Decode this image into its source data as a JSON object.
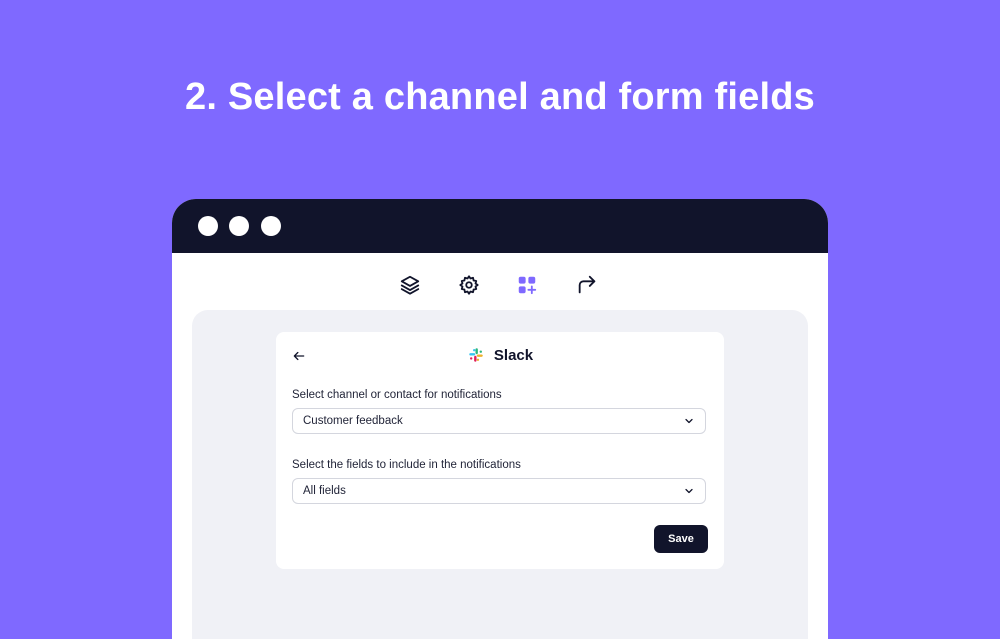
{
  "headline": "2. Select a channel and form fields",
  "toolbar": {
    "items": [
      {
        "icon": "layers-icon",
        "active": false
      },
      {
        "icon": "gear-icon",
        "active": false
      },
      {
        "icon": "apps-add-icon",
        "active": true
      },
      {
        "icon": "share-arrow-icon",
        "active": false
      }
    ]
  },
  "card": {
    "title": "Slack",
    "channel_label": "Select channel or contact for notifications",
    "channel_value": "Customer feedback",
    "fields_label": "Select the fields to include in the notifications",
    "fields_value": "All fields",
    "save_label": "Save"
  },
  "colors": {
    "background": "#7f69ff",
    "titlebar": "#11142b",
    "accent": "#7f69ff",
    "canvas": "#f0f1f6",
    "button": "#11142b"
  }
}
